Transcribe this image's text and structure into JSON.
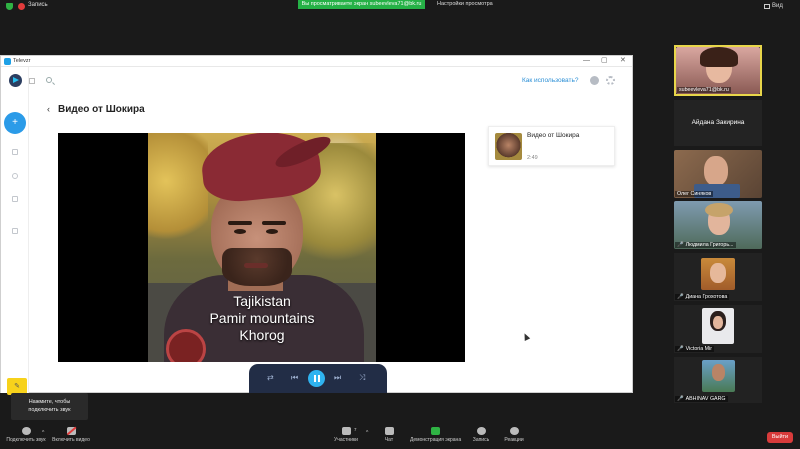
{
  "zoom_top": {
    "recording_label": "Запись",
    "share_banner": "Вы просматриваете экран subeevleva71@bk.ru",
    "view_settings": "Настройки просмотра",
    "view_label": "Вид"
  },
  "window": {
    "title": "Televzr",
    "minimize": "—",
    "maximize": "▢",
    "close": "✕"
  },
  "app": {
    "help_link": "Как использовать?",
    "page_title": "Видео от Шокира",
    "back": "‹",
    "fab": "+"
  },
  "video": {
    "caption_lines": [
      "Tajikistan",
      "Pamir mountains",
      "Khorog"
    ]
  },
  "playlist": [
    {
      "title": "Видео от Шокира",
      "duration": "2:49"
    }
  ],
  "controls": {
    "repeat": "⇄",
    "prev": "⏮",
    "next": "⏭",
    "shuffle": "⤨"
  },
  "participants": [
    {
      "name": "subeevleva71@bk.ru",
      "muted": false,
      "video": true
    },
    {
      "name": "Айдана Закирина",
      "muted": false,
      "video": false
    },
    {
      "name": "Олег Синяков",
      "muted": false,
      "video": true
    },
    {
      "name": "Людмила Григорь...",
      "muted": true,
      "video": true
    },
    {
      "name": "Диана Грохотова",
      "muted": true,
      "video": true
    },
    {
      "name": "Victoria Mir",
      "muted": true,
      "video": true
    },
    {
      "name": "ABHINAV GARG",
      "muted": true,
      "video": true
    }
  ],
  "tooltip": {
    "line1": "Нажмите, чтобы",
    "line2": "подключить звук"
  },
  "bottom_bar": {
    "join_audio": "Подключить звук",
    "start_video": "Включить видео",
    "participants": "Участники",
    "participants_count": "7",
    "chat": "Чат",
    "share_screen": "Демонстрация экрана",
    "record": "Запись",
    "reactions": "Реакции",
    "leave": "Выйти"
  },
  "colors": {
    "accent": "#2b9be8",
    "zoom_green": "#25b146",
    "leave_red": "#d83b3b",
    "player_bar": "#222d46"
  }
}
